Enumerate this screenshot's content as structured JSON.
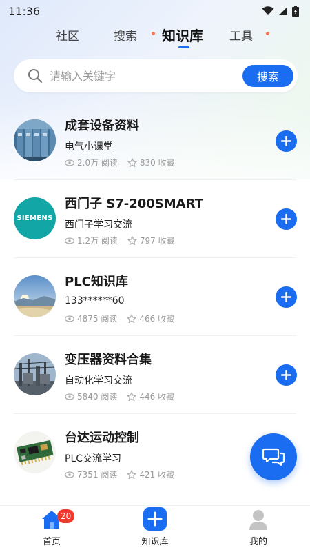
{
  "status_bar": {
    "time": "11:36"
  },
  "top_tabs": [
    {
      "label": "社区",
      "active": false,
      "dot": false
    },
    {
      "label": "搜索",
      "active": false,
      "dot": true
    },
    {
      "label": "知识库",
      "active": true,
      "dot": false
    },
    {
      "label": "工具",
      "active": false,
      "dot": true
    }
  ],
  "search": {
    "placeholder": "请输入关键字",
    "button_label": "搜索"
  },
  "colors": {
    "accent": "#1a6cf0",
    "badge": "#f03a2e",
    "dot": "#f07a5a"
  },
  "items": [
    {
      "title": "成套设备资料",
      "subtitle": "电气小课堂",
      "views": "2.0万 阅读",
      "favorites": "830 收藏",
      "image": "switchgear-image"
    },
    {
      "title": "西门子 S7-200SMART",
      "subtitle": "西门子学习交流",
      "views": "1.2万 阅读",
      "favorites": "797 收藏",
      "image": "siemens-logo",
      "logo_text": "SIEMENS"
    },
    {
      "title": "PLC知识库",
      "subtitle": "133******60",
      "views": "4875 阅读",
      "favorites": "466 收藏",
      "image": "landscape-image"
    },
    {
      "title": "变压器资料合集",
      "subtitle": "自动化学习交流",
      "views": "5840 阅读",
      "favorites": "446 收藏",
      "image": "substation-image"
    },
    {
      "title": "台达运动控制",
      "subtitle": "PLC交流学习",
      "views": "7351 阅读",
      "favorites": "421 收藏",
      "image": "circuit-board-image"
    }
  ],
  "bottom_nav": [
    {
      "label": "首页",
      "icon": "home-icon",
      "badge": "20"
    },
    {
      "label": "知识库",
      "icon": "add-icon"
    },
    {
      "label": "我的",
      "icon": "user-icon"
    }
  ]
}
